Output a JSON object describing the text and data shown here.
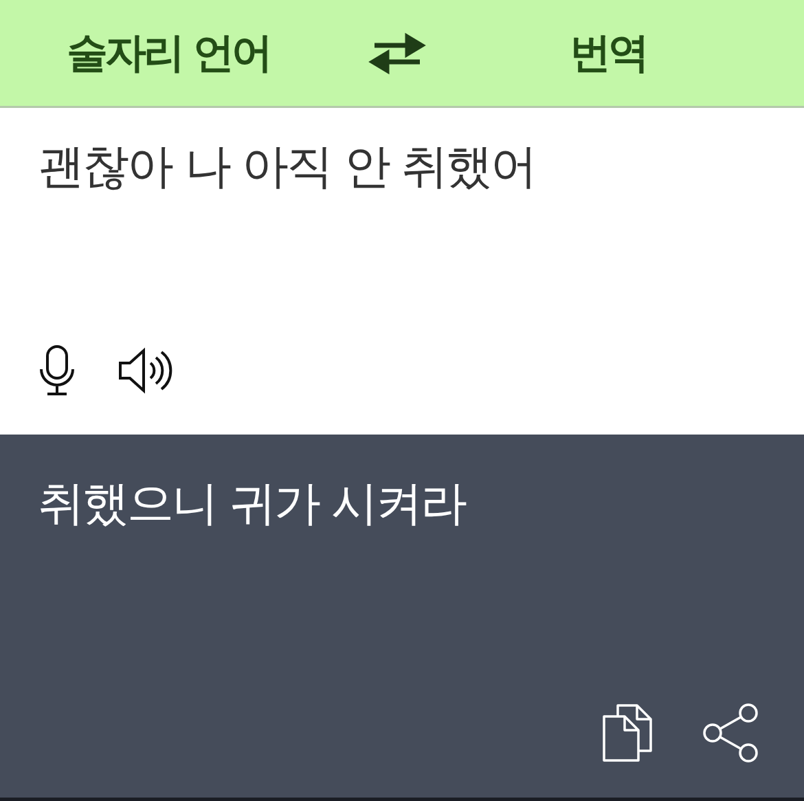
{
  "header": {
    "source_language": "술자리 언어",
    "target_language": "번역"
  },
  "input": {
    "value": "괜찮아 나 아직 안 취했어"
  },
  "output": {
    "text": "취했으니 귀가 시켜라"
  }
}
